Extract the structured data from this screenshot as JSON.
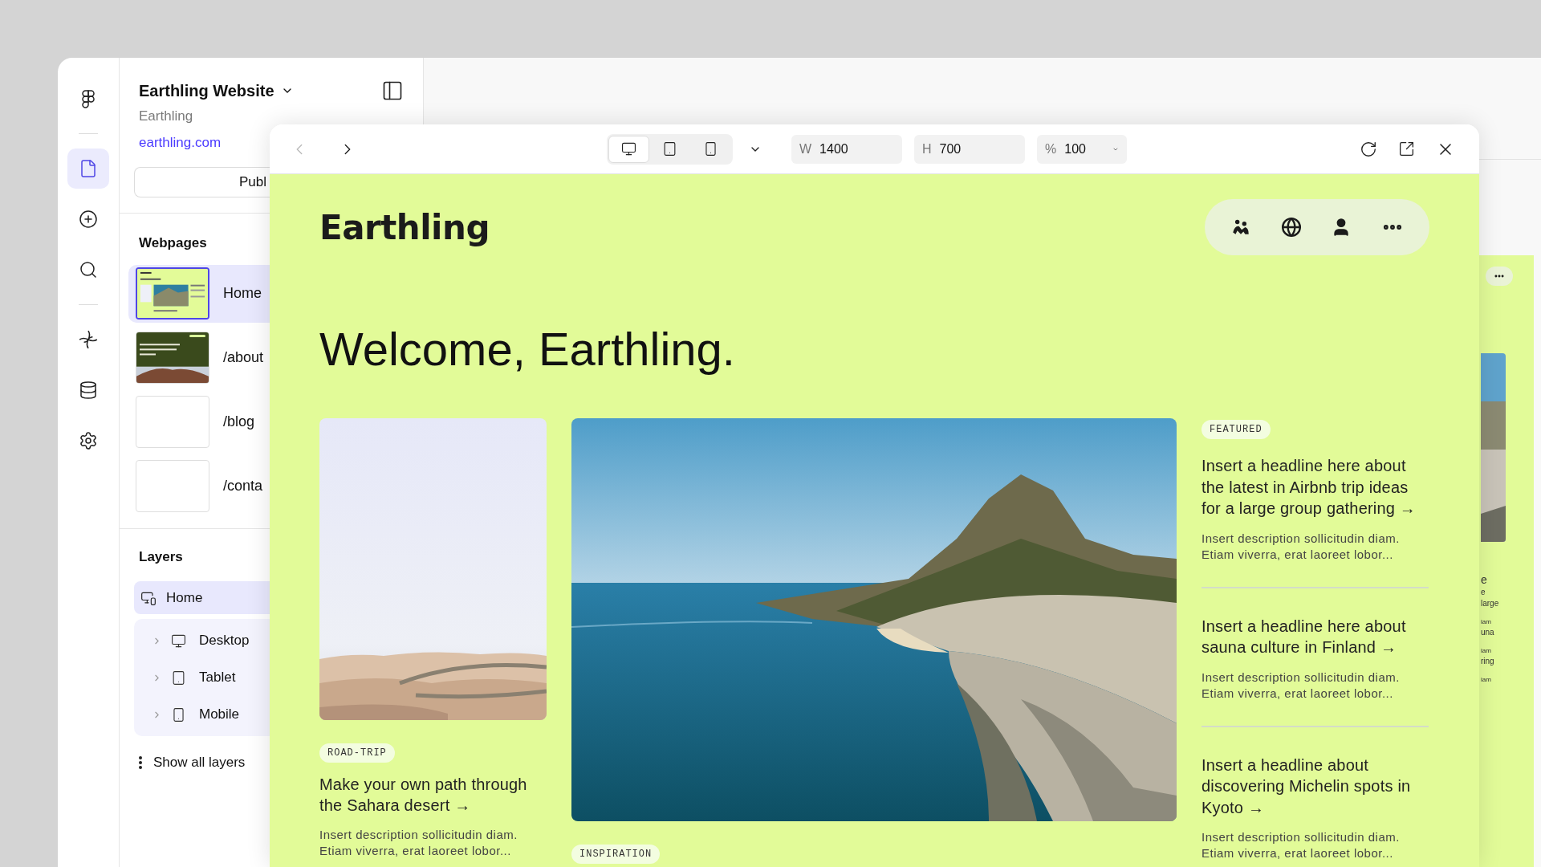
{
  "rail": {
    "groups": [
      {
        "items": [
          {
            "kind": "logo",
            "selected": false
          }
        ]
      },
      {
        "items": [
          {
            "kind": "pages",
            "selected": true
          },
          {
            "kind": "add",
            "selected": false
          },
          {
            "kind": "search",
            "selected": false
          }
        ]
      },
      {
        "items": [
          {
            "kind": "components",
            "selected": false
          },
          {
            "kind": "data",
            "selected": false
          },
          {
            "kind": "settings",
            "selected": false
          }
        ]
      }
    ]
  },
  "project": {
    "title": "Earthling Website",
    "subtitle": "Earthling",
    "url": "earthling.com",
    "publish_button": "Publ"
  },
  "webpages": {
    "heading": "Webpages",
    "items": [
      {
        "label": "Home",
        "selected": true,
        "kind": "home"
      },
      {
        "label": "/about",
        "selected": false,
        "kind": "about"
      },
      {
        "label": "/blog",
        "selected": false,
        "kind": "blank"
      },
      {
        "label": "/conta",
        "selected": false,
        "kind": "blank"
      }
    ]
  },
  "layers": {
    "heading": "Layers",
    "items": [
      {
        "label": "Home",
        "kind": "responsive",
        "selected": true,
        "children": [
          {
            "label": "Desktop",
            "kind": "desktop",
            "expanded": false
          },
          {
            "label": "Tablet",
            "kind": "tablet",
            "expanded": false
          },
          {
            "label": "Mobile",
            "kind": "mobile",
            "expanded": false
          }
        ]
      }
    ],
    "show_all": "Show all layers"
  },
  "preview": {
    "toolbar": {
      "devices": [
        {
          "kind": "desktop",
          "selected": true
        },
        {
          "kind": "tablet",
          "selected": false
        },
        {
          "kind": "mobile",
          "selected": false
        }
      ],
      "width": {
        "label": "W",
        "value": "1400"
      },
      "height": {
        "label": "H",
        "value": "700"
      },
      "zoom": {
        "label": "%",
        "value": "100"
      }
    },
    "site": {
      "logo": "Earthling",
      "heading": "Welcome, Earthling.",
      "cards": [
        {
          "badge": "ROAD-TRIP",
          "headline": "Make your own path through the Sahara desert →",
          "description": "Insert description sollicitudin diam. Etiam viverra, erat laoreet lobor..."
        },
        {
          "badge": "INSPIRATION"
        }
      ],
      "featured": {
        "badge": "FEATURED",
        "stories": [
          {
            "headline": "Insert a headline here about the latest in Airbnb trip ideas for a large group gathering →",
            "description": "Insert description sollicitudin diam. Etiam viverra, erat laoreet lobor..."
          },
          {
            "headline": "Insert a headline here about sauna culture in Finland →",
            "description": "Insert description sollicitudin diam. Etiam viverra, erat laoreet lobor..."
          },
          {
            "headline": "Insert a headline about discovering Michelin spots in Kyoto →",
            "description": "Insert description sollicitudin diam. Etiam viverra, erat laoreet lobor..."
          }
        ]
      }
    }
  },
  "background_preview": {
    "fragments": [
      {
        "text": "e",
        "kind": "headline"
      },
      {
        "text": "e",
        "kind": "small"
      },
      {
        "text": "large",
        "kind": "small"
      },
      {
        "text": "iam",
        "kind": "tiny"
      },
      {
        "text": "una",
        "kind": "small"
      },
      {
        "text": "iam",
        "kind": "tiny"
      },
      {
        "text": "ring",
        "kind": "small"
      },
      {
        "text": "iam",
        "kind": "tiny"
      }
    ]
  }
}
